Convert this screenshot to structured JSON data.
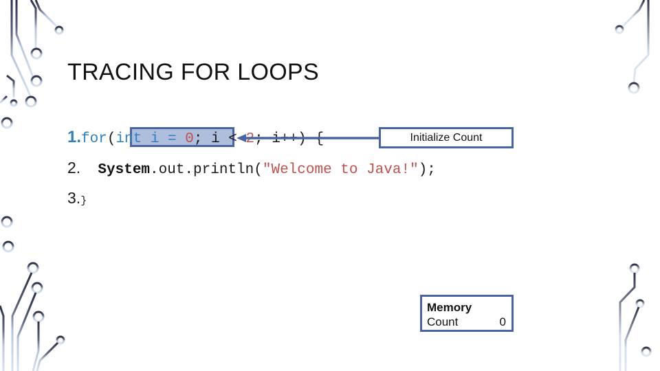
{
  "slide": {
    "title": "TRACING FOR LOOPS",
    "code": {
      "line1": {
        "number": "1.",
        "kw_for": "for",
        "paren_open": "(",
        "init": "int i = ",
        "init_value": "0",
        "init_semicolon": ";",
        "cond_pre": " i < ",
        "cond_value": "2",
        "cond_post": "; i++) {"
      },
      "line2": {
        "number": "2.",
        "system": "System",
        "call": ".out.println(",
        "string": "\"Welcome to Java!\"",
        "end": ");"
      },
      "line3": {
        "number": "3.",
        "brace": "}"
      }
    },
    "callout": {
      "label": "Initialize Count"
    },
    "memory": {
      "title": "Memory",
      "variables": [
        {
          "name": "Count",
          "value": "0"
        }
      ]
    },
    "colors": {
      "accent": "#4a63a6",
      "keyword": "#2f7fc1",
      "literal": "#c0504d",
      "highlight_fill": "#a8b5da"
    }
  }
}
